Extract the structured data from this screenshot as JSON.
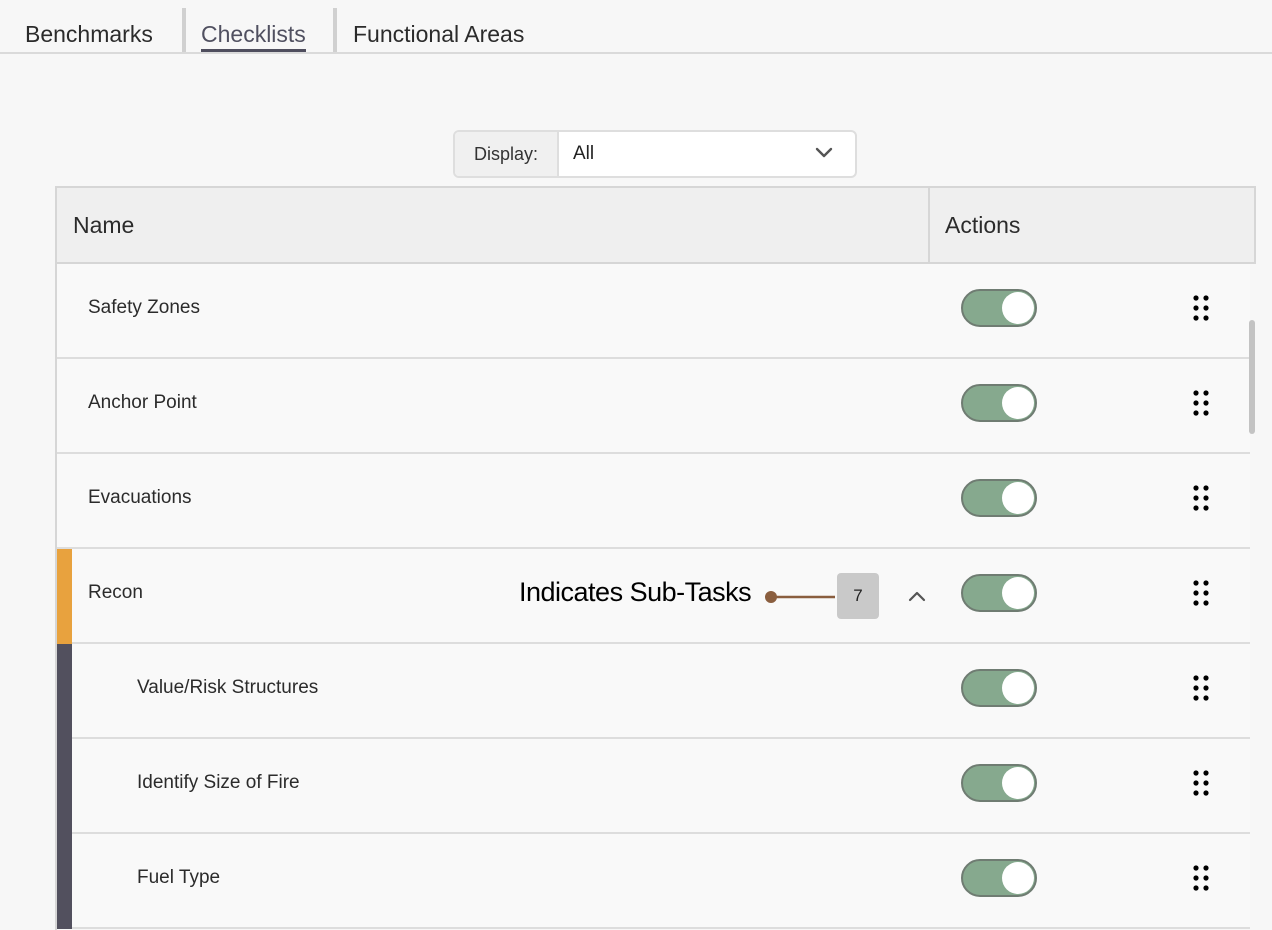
{
  "tabs": [
    {
      "label": "Benchmarks"
    },
    {
      "label": "Checklists"
    },
    {
      "label": "Functional Areas"
    }
  ],
  "display_filter": {
    "label": "Display:",
    "value": "All"
  },
  "table": {
    "headers": {
      "name": "Name",
      "actions": "Actions"
    },
    "rows": [
      {
        "label": "Safety Zones",
        "enabled": true
      },
      {
        "label": "Anchor Point",
        "enabled": true
      },
      {
        "label": "Evacuations",
        "enabled": true
      },
      {
        "label": "Recon",
        "enabled": true,
        "subtask_count": "7",
        "expanded": true
      },
      {
        "label": "Value/Risk Structures",
        "enabled": true
      },
      {
        "label": "Identify Size of Fire",
        "enabled": true
      },
      {
        "label": "Fuel Type",
        "enabled": true
      }
    ]
  },
  "annotation": {
    "text": "Indicates Sub-Tasks"
  },
  "colors": {
    "toggle_on": "#86a98e",
    "parent_accent": "#e8a23e",
    "subtask_accent": "#52505e"
  },
  "icons": {
    "filter_dropdown": "chevron-down-icon",
    "collapse": "chevron-up-icon",
    "drag": "drag-handle-icon"
  }
}
